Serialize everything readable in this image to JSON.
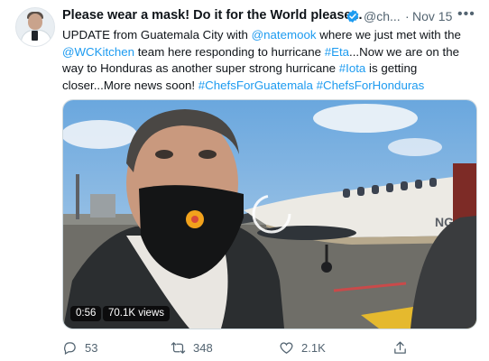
{
  "tweet": {
    "author_name": "Please wear a mask! Do it for the World please...",
    "handle": "@ch...",
    "separator": "·",
    "date": "Nov 15",
    "more": "•••",
    "text": {
      "l1": {
        "a": "UPDATE from Guatemala City with ",
        "mention": "@natemook",
        "b": " where we just met with the"
      },
      "l2": {
        "mention": "@WCKitchen",
        "a": " team here responding to hurricane ",
        "tag": "#Eta",
        "b": "...Now we are on the"
      },
      "l3": {
        "a": "way to Honduras as another super strong hurricane ",
        "tag": "#Iota",
        "b": " is getting"
      },
      "l4": {
        "a": "closer...More news soon! ",
        "tag1": "#ChefsForGuatemala",
        "sp": " ",
        "tag2": "#ChefsForHonduras"
      }
    },
    "video": {
      "duration": "0:56",
      "views": "70.1K views",
      "plane_reg": "NG"
    },
    "actions": {
      "replies": "53",
      "retweets": "348",
      "likes": "2.1K"
    }
  },
  "colors": {
    "link": "#1d9bf0",
    "muted": "#536471",
    "verified": "#1d9bf0"
  },
  "icons": [
    "verified-badge-icon",
    "more-options-icon",
    "reply-icon",
    "retweet-icon",
    "like-icon",
    "share-icon",
    "play-loading-icon"
  ]
}
